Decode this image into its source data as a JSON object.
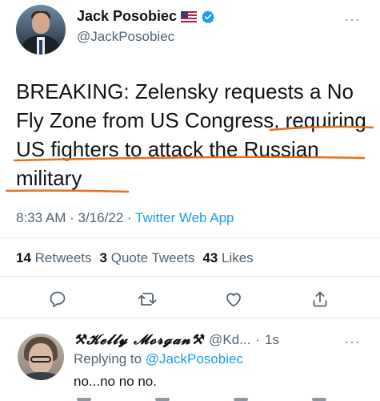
{
  "tweet": {
    "display_name": "Jack Posobiec",
    "handle": "@JackPosobiec",
    "more": "···",
    "text": "BREAKING: Zelensky requests a No Fly Zone from US Congress, requiring US fighters to attack the Russian military",
    "time": "8:33 AM",
    "date": "3/16/22",
    "app": "Twitter Web App",
    "retweets": {
      "count": "14",
      "label": "Retweets"
    },
    "quote_tweets": {
      "count": "3",
      "label": "Quote Tweets"
    },
    "likes": {
      "count": "43",
      "label": "Likes"
    },
    "icons": [
      "flag-us-icon",
      "verified-badge-icon",
      "reply-icon",
      "retweet-icon",
      "like-icon",
      "share-icon"
    ]
  },
  "reply": {
    "display_name": "⚒𝓚𝓮𝓵𝓵𝔂 𝓜𝓸𝓻𝓰𝓪𝓷⚒",
    "handle": "@Kd...",
    "time": "1s",
    "more": "···",
    "replying_prefix": "Replying to",
    "replying_to": "@JackPosobiec",
    "text": "no...no no no."
  },
  "colors": {
    "accent": "#1d9bf0",
    "secondary_text": "#536471",
    "annotation": "#e8701c"
  }
}
